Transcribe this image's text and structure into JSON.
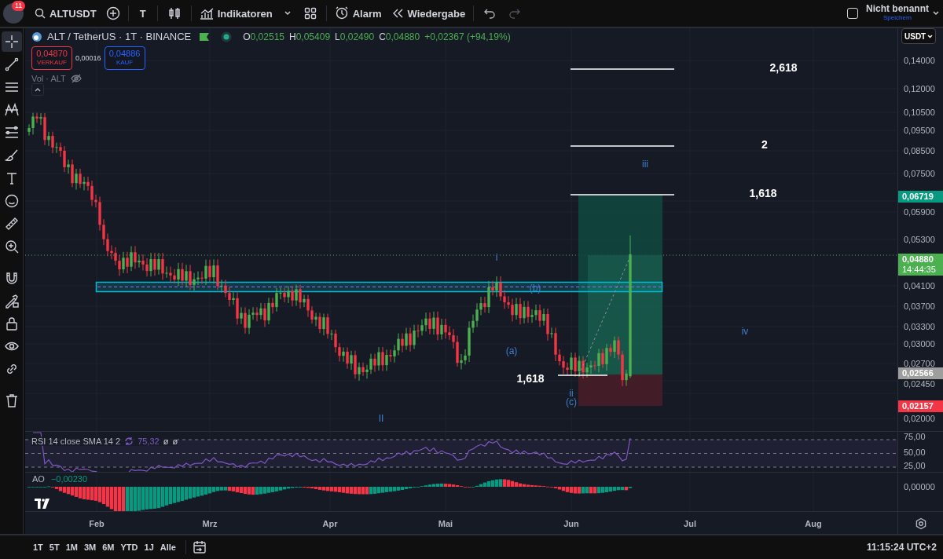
{
  "topbar": {
    "avatar_badge": "11",
    "symbol": "ALTUSDT",
    "interval": "T",
    "indicators": "Indikatoren",
    "alarm": "Alarm",
    "replay": "Wiedergabe",
    "undo_disabled": false,
    "redo_disabled": true,
    "layout_checked": false,
    "layout_name": "Nicht benannt",
    "save": "Speichern"
  },
  "tools": [
    {
      "selected": true
    },
    {
      "selected": false
    },
    {
      "selected": false
    },
    {
      "selected": false
    },
    {
      "selected": false
    },
    {
      "selected": false
    },
    {
      "selected": false
    },
    {
      "selected": false
    },
    {
      "selected": false
    },
    {
      "selected": false
    },
    {
      "selected": false
    },
    {
      "selected": false
    },
    {
      "selected": false
    },
    {
      "selected": false
    },
    {
      "selected": false
    },
    {
      "selected": false
    }
  ],
  "legend": {
    "title": "ALT / TetherUS · 1T · BINANCE",
    "ohlc": [
      {
        "key": "O",
        "value": "0,02515"
      },
      {
        "key": "H",
        "value": "0,05409"
      },
      {
        "key": "L",
        "value": "0,02490"
      },
      {
        "key": "C",
        "value": "0,04880"
      }
    ],
    "change": "+0,02367 (+94,19%)",
    "sell": {
      "price": "0,04870",
      "label": "VERKAUF"
    },
    "spread": "0,00016",
    "buy": {
      "price": "0,04886",
      "label": "KAUF"
    },
    "volume": "Vol · ALT"
  },
  "annotations": {
    "fib_levels": [
      "2,618",
      "2",
      "1,618"
    ],
    "fib_small": "1,618",
    "waves": [
      "i",
      "(b)",
      "(a)",
      "ii",
      "(c)",
      "iii",
      "iv",
      "II"
    ]
  },
  "price_axis": {
    "currency": "USDT",
    "ticks": [
      "0,14000",
      "0,12000",
      "0,10500",
      "0,09500",
      "0,08500",
      "0,07500",
      "0,05900",
      "0,05300",
      "0,04100",
      "0,03700",
      "0,03300",
      "0,03000",
      "0,02700",
      "0,02450",
      "0,02000"
    ],
    "badges": [
      {
        "value": "0,06719",
        "color": "#089981"
      },
      {
        "value": "0,04880",
        "time": "14:44:35",
        "color": "#4caf50"
      },
      {
        "value": "0,02566",
        "color": "#9e9e9e"
      },
      {
        "value": "0,02157",
        "color": "#f23645"
      }
    ]
  },
  "rsi": {
    "title": "RSI 14 close SMA 14 2",
    "value": "75,32",
    "extras": [
      "ø",
      "ø"
    ],
    "ticks": [
      "75,00",
      "50,00",
      "25,00"
    ]
  },
  "ao": {
    "title": "AO",
    "value": "−0,00230",
    "ticks": [
      "0,00000"
    ]
  },
  "time_axis": [
    "Feb",
    "Mrz",
    "Apr",
    "Mai",
    "Jun",
    "Jul",
    "Aug"
  ],
  "ranges": [
    "1T",
    "5T",
    "1M",
    "3M",
    "6M",
    "YTD",
    "1J",
    "Alle"
  ],
  "clock": "11:15:24 UTC+2"
}
